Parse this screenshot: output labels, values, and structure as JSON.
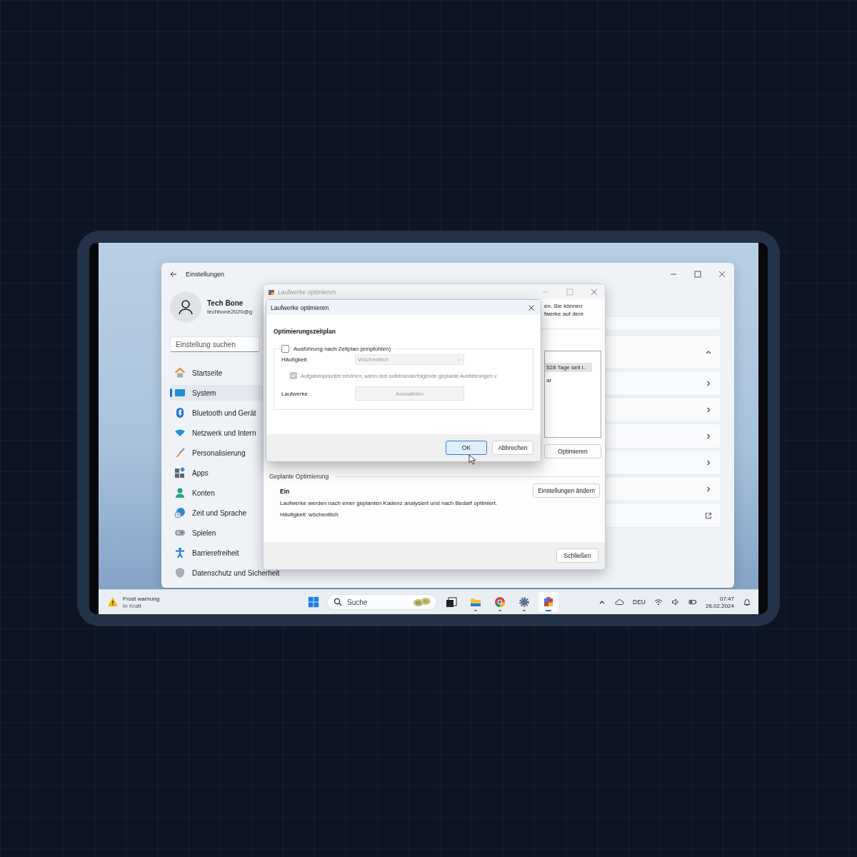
{
  "settings_window": {
    "title": "Einstellungen",
    "user": {
      "name": "Tech Bone",
      "email": "techbone2020@g"
    },
    "search": {
      "placeholder": "Einstellung suchen"
    },
    "nav_items": [
      {
        "kind": "home",
        "label": "Startseite",
        "selected": false
      },
      {
        "kind": "system",
        "label": "System",
        "selected": true
      },
      {
        "kind": "bluetooth",
        "label": "Bluetooth und Gerät",
        "selected": false
      },
      {
        "kind": "network",
        "label": "Netzwerk und Intern",
        "selected": false
      },
      {
        "kind": "personalization",
        "label": "Personalisierung",
        "selected": false
      },
      {
        "kind": "apps",
        "label": "Apps",
        "selected": false
      },
      {
        "kind": "accounts",
        "label": "Konten",
        "selected": false
      },
      {
        "kind": "time",
        "label": "Zeit und Sprache",
        "selected": false
      },
      {
        "kind": "gaming",
        "label": "Spielen",
        "selected": false
      },
      {
        "kind": "accessibility",
        "label": "Barrierefreiheit",
        "selected": false
      },
      {
        "kind": "privacy",
        "label": "Datenschutz und Sicherheit",
        "selected": false
      }
    ],
    "cards": [
      {
        "kind": "collapse"
      },
      {
        "kind": "open"
      },
      {
        "kind": "open"
      },
      {
        "kind": "open"
      },
      {
        "kind": "open"
      },
      {
        "kind": "open"
      },
      {
        "kind": "external"
      }
    ]
  },
  "optimize_dialog": {
    "title": "Laufwerke optimieren",
    "text_lines": [
      "en. Sie können",
      "fwerke auf dem"
    ],
    "drive_rows": [
      {
        "text": "528 Tage seit l..",
        "selected": true
      },
      {
        "text": "ar",
        "selected": false
      }
    ],
    "optimize_button": "Optimieren",
    "scheduled": {
      "heading": "Geplante Optimierung",
      "status": "Ein",
      "description": "Laufwerke werden nach einer geplanten Kadenz analysiert und nach Bedarf optimiert.",
      "frequency": "Häufigkeit: wöchentlich",
      "button": "Einstellungen ändern"
    },
    "close_button": "Schließen"
  },
  "schedule_dialog": {
    "title": "Laufwerke optimieren",
    "heading": "Optimierungszeitplan",
    "run_on_schedule": {
      "label": "Ausführung nach Zeitplan (empfohlen)",
      "checked": false
    },
    "frequency": {
      "label": "Häufigkeit",
      "value": "Wöchentlich",
      "disabled": true
    },
    "priority": {
      "label": "Aufgabenpriorität erhöhen, wenn drei aufeinanderfolgende geplante Ausführungen v",
      "checked": true,
      "disabled": true
    },
    "drives": {
      "label": "Laufwerke",
      "button": "Auswählen",
      "disabled": true
    },
    "buttons": [
      {
        "label": "OK",
        "selected": true
      },
      {
        "label": "Abbrechen",
        "selected": false
      }
    ]
  },
  "taskbar": {
    "weather": {
      "title": "Frost warnung",
      "subtitle": "In Kraft"
    },
    "search": {
      "placeholder": "Suche"
    },
    "apps": [
      {
        "kind": "task-view",
        "running": false,
        "selected": false
      },
      {
        "kind": "folder",
        "running": true,
        "selected": false
      },
      {
        "kind": "chrome",
        "running": true,
        "selected": false
      },
      {
        "kind": "settings",
        "running": true,
        "selected": false
      },
      {
        "kind": "defrag",
        "running": true,
        "selected": true
      }
    ],
    "language": "DEU",
    "time": "07:47",
    "date": "26.02.2024"
  }
}
